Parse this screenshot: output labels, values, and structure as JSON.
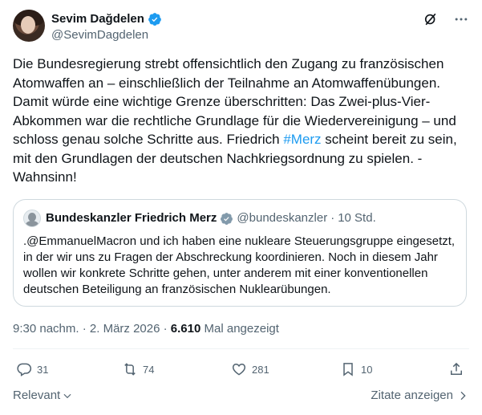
{
  "author": {
    "display_name": "Sevim Dağdelen",
    "handle": "@SevimDagdelen"
  },
  "tweet": {
    "text_before_hashtag": "Die Bundesregierung strebt offensichtlich den Zugang zu französischen Atomwaffen an – einschließlich der Teilnahme an Atomwaffenübungen. Damit würde eine wichtige Grenze überschritten: Das Zwei-plus-Vier-Abkommen war die rechtliche Grundlage für die Wiedervereinigung – und schloss genau solche Schritte aus. Friedrich ",
    "hashtag": "#Merz",
    "text_after_hashtag": " scheint bereit zu sein, mit den Grundlagen der deutschen Nachkriegsordnung zu spielen. -Wahnsinn!"
  },
  "quote": {
    "display_name": "Bundeskanzler Friedrich Merz",
    "handle": "@bundeskanzler",
    "separator": "·",
    "time": "10 Std.",
    "text": ".@EmmanuelMacron und ich haben eine nukleare Steuerungsgruppe eingesetzt, in der wir uns zu Fragen der Abschreckung koordinieren. Noch in diesem Jahr wollen wir konkrete Schritte gehen, unter anderem mit einer konventionellen deutschen Beteiligung an französischen Nuklearübungen."
  },
  "meta": {
    "time": "9:30 nachm.",
    "sep1": "·",
    "date": "2. März 2026",
    "sep2": "·",
    "views": "6.610",
    "views_label": "Mal angezeigt"
  },
  "actions": {
    "replies": "31",
    "reposts": "74",
    "likes": "281",
    "bookmarks": "10"
  },
  "footer": {
    "sort_label": "Relevant",
    "quotes_link": "Zitate anzeigen"
  },
  "colors": {
    "accent": "#1d9bf0",
    "text": "#0f1419",
    "secondary": "#536471",
    "border": "#cfd9de"
  }
}
